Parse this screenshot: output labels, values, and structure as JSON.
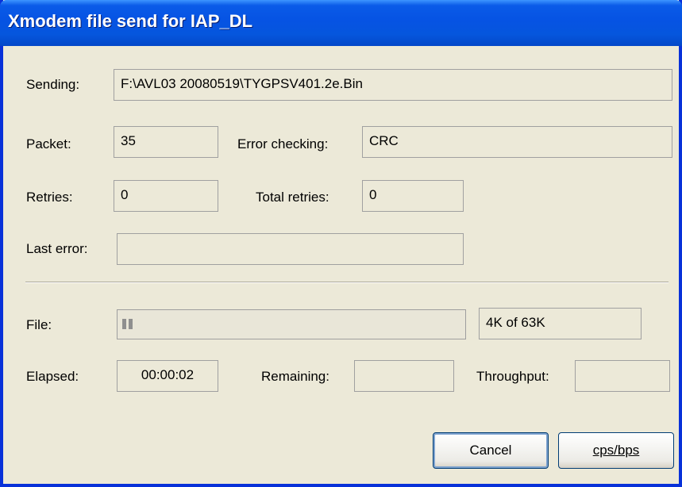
{
  "window": {
    "title": "Xmodem file send for IAP_DL"
  },
  "fields": {
    "sending": {
      "label": "Sending:",
      "value": "F:\\AVL03 20080519\\TYGPSV401.2e.Bin"
    },
    "packet": {
      "label": "Packet:",
      "value": "35"
    },
    "error_checking": {
      "label": "Error checking:",
      "value": "CRC"
    },
    "retries": {
      "label": "Retries:",
      "value": "0"
    },
    "total_retries": {
      "label": "Total retries:",
      "value": "0"
    },
    "last_error": {
      "label": "Last error:",
      "value": ""
    }
  },
  "progress": {
    "file_label": "File:",
    "fraction": 0.0635,
    "size_text": "4K of 63K"
  },
  "timing": {
    "elapsed_label": "Elapsed:",
    "elapsed_value": "00:00:02",
    "remaining_label": "Remaining:",
    "remaining_value": "",
    "throughput_label": "Throughput:",
    "throughput_value": ""
  },
  "buttons": {
    "cancel": "Cancel",
    "cps_bps": "cps/bps"
  },
  "colors": {
    "titlebar": "#0653E3",
    "dialog_bg": "#ECE9D8",
    "progress_fill": "#8F8F8F"
  }
}
